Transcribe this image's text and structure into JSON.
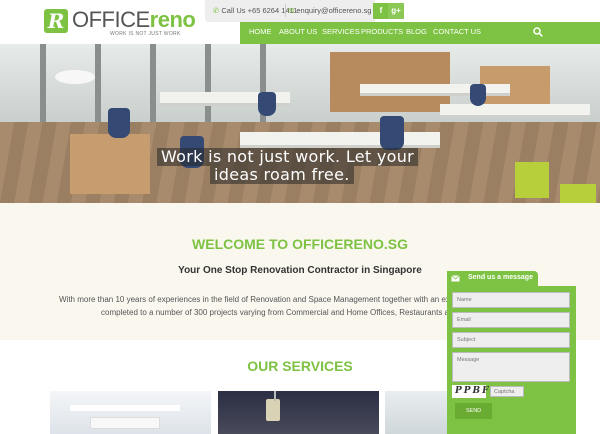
{
  "logo": {
    "word1": "OFFICE",
    "word2": "reno",
    "tagline": "WORK IS NOT JUST WORK",
    "mark": "R"
  },
  "topbar": {
    "phone": "Call Us +65 6264 1411",
    "email": "enquiry@officereno.sg",
    "social": [
      "f",
      "g+"
    ]
  },
  "nav": {
    "items": [
      "HOME",
      "ABOUT US",
      "SERVICES",
      "PRODUCTS",
      "BLOG",
      "CONTACT US"
    ]
  },
  "hero": {
    "line1": "Work is not just work. Let your",
    "line2": "ideas roam free."
  },
  "welcome": {
    "title": "WELCOME TO OFFICERENO.SG",
    "subtitle": "Your One Stop Renovation Contractor in Singapore",
    "para_line1": "With more than 10 years of experiences in the field of Renovation and Space Management together with an ext",
    "para_line2": "completed to a number of 300 projects varying from Commercial and Home Offices, Restaurants a"
  },
  "services": {
    "title": "OUR SERVICES"
  },
  "contact_widget": {
    "tab_label": "Send us a message",
    "name_placeholder": "Name",
    "email_placeholder": "Email",
    "subject_placeholder": "Subject",
    "message_placeholder": "Message",
    "captcha_text": "PPBF",
    "captcha_placeholder": "Captcha",
    "send_label": "SEND"
  },
  "colors": {
    "brand_green": "#7dc242"
  }
}
